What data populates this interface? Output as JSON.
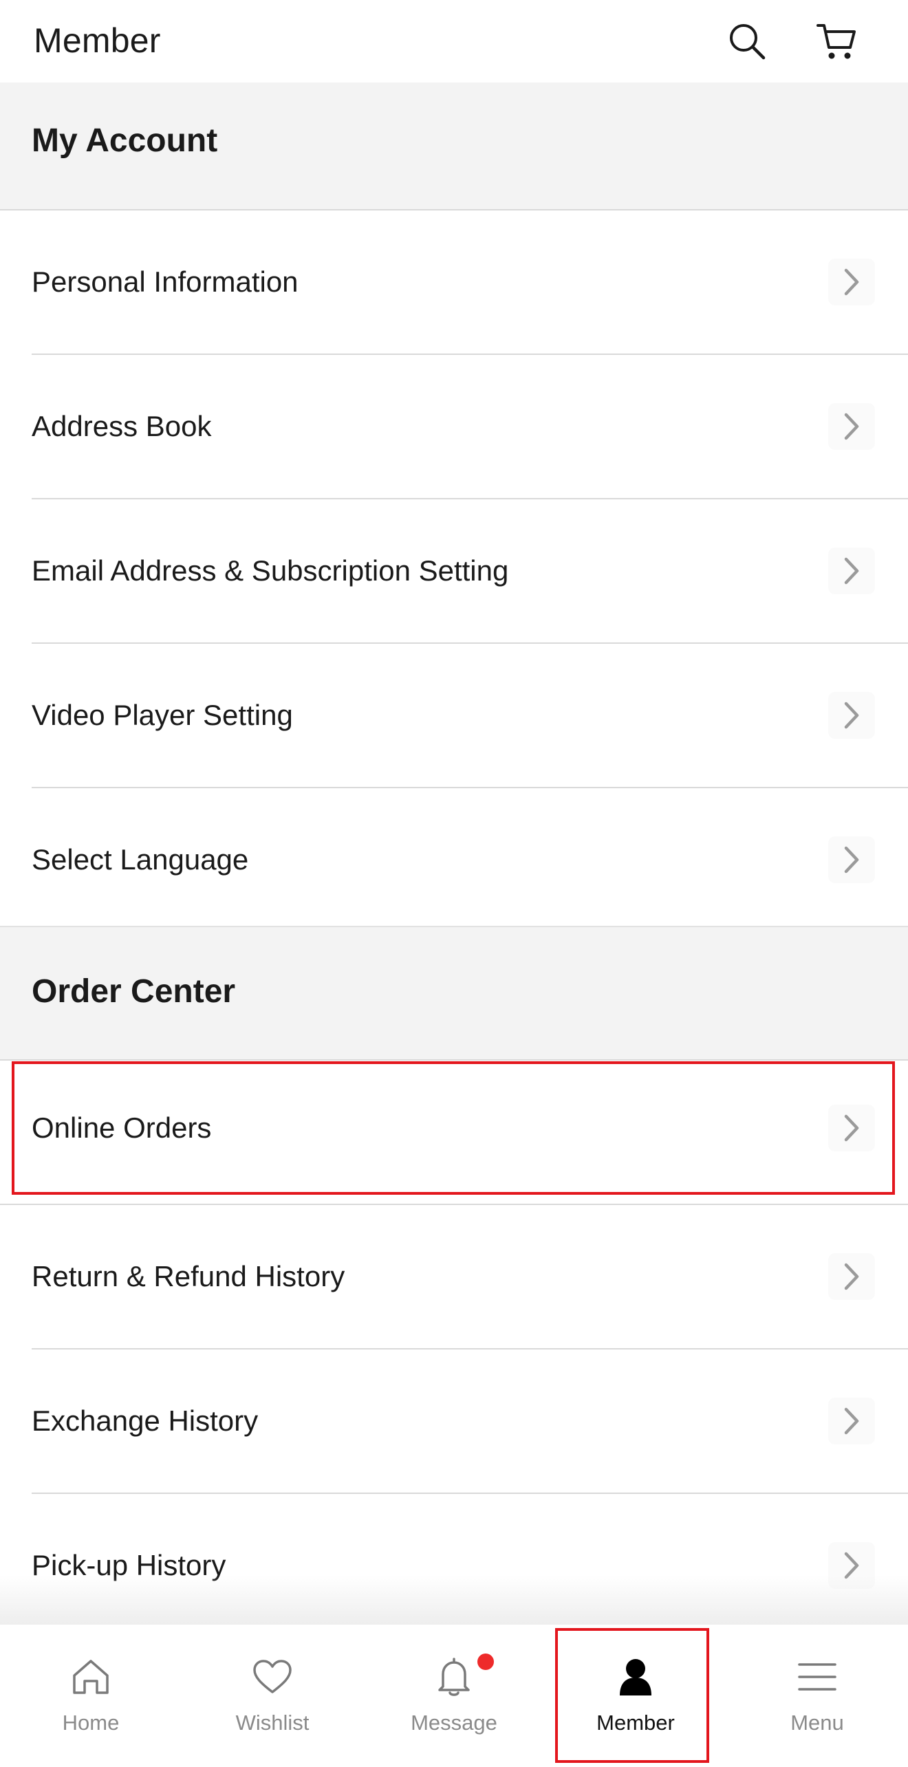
{
  "header": {
    "title": "Member",
    "search_icon": "search-icon",
    "cart_icon": "cart-icon"
  },
  "sections": [
    {
      "title": "My Account",
      "items": [
        {
          "label": "Personal Information"
        },
        {
          "label": "Address Book"
        },
        {
          "label": "Email Address & Subscription Setting"
        },
        {
          "label": "Video Player Setting"
        },
        {
          "label": "Select Language"
        }
      ]
    },
    {
      "title": "Order Center",
      "items": [
        {
          "label": "Online Orders"
        },
        {
          "label": "Return & Refund History"
        },
        {
          "label": "Exchange History"
        },
        {
          "label": "Pick-up History"
        }
      ]
    }
  ],
  "tabbar": {
    "tabs": [
      {
        "label": "Home",
        "icon": "home-icon"
      },
      {
        "label": "Wishlist",
        "icon": "heart-icon"
      },
      {
        "label": "Message",
        "icon": "bell-icon",
        "badge": true
      },
      {
        "label": "Member",
        "icon": "person-icon",
        "active": true
      },
      {
        "label": "Menu",
        "icon": "hamburger-icon"
      }
    ]
  },
  "colors": {
    "highlight": "#e3161d",
    "badge": "#ee2a2a",
    "section_bg": "#f3f3f3",
    "chevron": "#9a9a9a"
  }
}
